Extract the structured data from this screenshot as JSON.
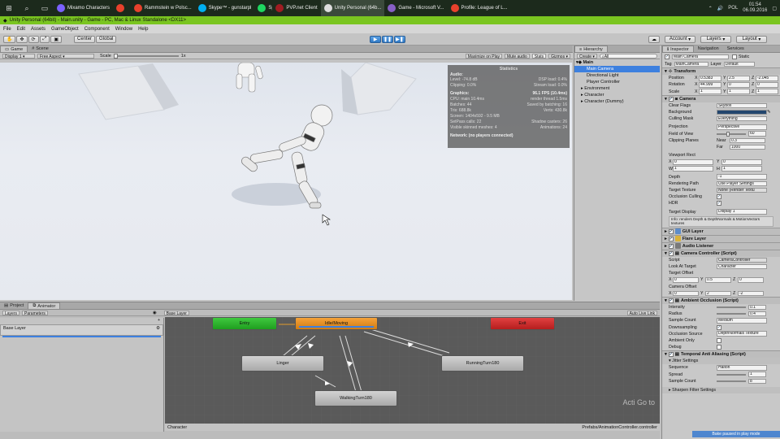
{
  "taskbar": {
    "items": [
      {
        "label": "Mixamo Characters",
        "color": "#7b61ff"
      },
      {
        "label": "",
        "color": "#e8412c"
      },
      {
        "label": "Rammstein w Polsc...",
        "color": "#e8412c"
      },
      {
        "label": "Skype™ - gunstarpl",
        "color": "#00aff0"
      },
      {
        "label": "Spotify",
        "color": "#1ed760"
      },
      {
        "label": "PVP.net Client",
        "color": "#a01c22"
      },
      {
        "label": "Unity Personal (64b...",
        "color": "#dddddd"
      },
      {
        "label": "Game - Microsoft V...",
        "color": "#865fc5"
      },
      {
        "label": "Profile: League of L...",
        "color": "#e8412c"
      }
    ],
    "lang": "POL",
    "time": "01:54",
    "date": "06.09.2016"
  },
  "window": {
    "title": "Unity Personal (64bit) - Main.unity - Game - PC, Mac & Linux Standalone <DX11>"
  },
  "menu": [
    "File",
    "Edit",
    "Assets",
    "GameObject",
    "Component",
    "Window",
    "Help"
  ],
  "toolbar": {
    "pivot": "Center",
    "space": "Global",
    "account": "Account",
    "layers": "Layers",
    "layout": "Layout"
  },
  "game": {
    "tabs": [
      "Game",
      "Scene"
    ],
    "display": "Display 1",
    "aspect": "Free Aspect",
    "scale_label": "Scale",
    "scale_value": "1x",
    "maximize": "Maximize on Play",
    "mute": "Mute audio",
    "stats": "Stats",
    "gizmos": "Gizmos"
  },
  "stats": {
    "title": "Statistics",
    "audio_h": "Audio:",
    "audio": [
      [
        "Level: -74.8 dB",
        "DSP load: 0.4%"
      ],
      [
        "Clipping: 0.0%",
        "Stream load: 0.0%"
      ]
    ],
    "graphics_h": "Graphics:",
    "fps": "96.1 FPS (10.4ms)",
    "graphics": [
      [
        "CPU: main 10.4ms",
        "render thread 1.5ms"
      ],
      [
        "Batches: 44",
        "Saved by batching: 16"
      ],
      [
        "Tris: 688.8k",
        "Verts: 430.8k"
      ],
      [
        "Screen: 1404x592 - 9.5 MB",
        ""
      ],
      [
        "SetPass calls: 22",
        "Shadow casters: 26"
      ],
      [
        "Visible skinned meshes: 4",
        "Animations: 24"
      ]
    ],
    "network": "Network: (no players connected)"
  },
  "hierarchy": {
    "title": "Hierarchy",
    "create": "Create",
    "search": "All",
    "scene": "Main",
    "items": [
      "Main Camera",
      "Directional Light",
      "Player Controller",
      "Environment",
      "Character",
      "Character (Dummy)"
    ]
  },
  "inspector": {
    "tabs": [
      "Inspector",
      "Navigation",
      "Services"
    ],
    "object_name": "Main Camera",
    "static": "Static",
    "tag_label": "Tag",
    "tag": "MainCamera",
    "layer_label": "Layer",
    "layer": "Default",
    "transform": {
      "title": "Transform",
      "position": [
        "0.5383",
        "2.5",
        "-2.045"
      ],
      "rotation": [
        "44.999",
        "0",
        "0"
      ],
      "scale": [
        "1",
        "1",
        "1"
      ]
    },
    "camera": {
      "title": "Camera",
      "clear_flags": "Skybox",
      "background_color": "#23466e",
      "culling_mask": "Everything",
      "projection": "Perspective",
      "fov": "60",
      "near": "0.3",
      "far": "1000",
      "viewport": [
        "0",
        "0",
        "1",
        "1"
      ],
      "depth": "-1",
      "rendering_path": "Use Player Settings",
      "target_texture": "None (Render Textu",
      "target_display": "Display 1",
      "info": "Info: renders Depth & DepthNormals & MotionVectors textures"
    },
    "labels": {
      "clear_flags": "Clear Flags",
      "background": "Background",
      "culling_mask": "Culling Mask",
      "projection": "Projection",
      "fov": "Field of View",
      "clipping": "Clipping Planes",
      "near": "Near",
      "far": "Far",
      "viewport": "Viewport Rect",
      "depth": "Depth",
      "rendering_path": "Rendering Path",
      "target_texture": "Target Texture",
      "occlusion": "Occlusion Culling",
      "hdr": "HDR",
      "target_display": "Target Display",
      "position": "Position",
      "rotation": "Rotation",
      "scale": "Scale"
    },
    "components": [
      "GUI Layer",
      "Flare Layer",
      "Audio Listener"
    ],
    "controller": {
      "title": "Camera Controller (Script)",
      "script_label": "Script",
      "script": "CameraController",
      "look_label": "Look At Target",
      "look": "Character",
      "target_offset_label": "Target Offset",
      "target_offset": [
        "0",
        "0.5",
        "0"
      ],
      "camera_offset_label": "Camera Offset",
      "camera_offset": [
        "0",
        "2",
        "-2"
      ]
    },
    "ao": {
      "title": "Ambient Occlusion (Script)",
      "rows": [
        [
          "Intensity",
          "0.1"
        ],
        [
          "Radius",
          "0.4"
        ],
        [
          "Sample Count",
          "Medium"
        ],
        [
          "Downsampling",
          ""
        ],
        [
          "Occlusion Source",
          "DepthNormals Texture"
        ],
        [
          "Ambient Only",
          ""
        ],
        [
          "Debug",
          ""
        ]
      ]
    },
    "taa": {
      "title": "Temporal Anti Aliasing (Script)",
      "jitter": "Jitter Settings",
      "rows": [
        [
          "Sequence",
          "Halton"
        ],
        [
          "Spread",
          "1"
        ],
        [
          "Sample Count",
          "8"
        ]
      ],
      "sharpen": "Sharpen Filter Settings"
    },
    "bake_status": "Bake paused in play mode"
  },
  "bottom": {
    "tabs": [
      "Project",
      "Animator"
    ],
    "subtabs": [
      "Layers",
      "Parameters"
    ],
    "base_layer": "Base Layer",
    "breadcrumb": "Base Layer",
    "auto_live": "Auto Live Link",
    "states": {
      "entry": "Entry",
      "idle": "Idle/Moving",
      "exit": "Exit",
      "linger": "Linger",
      "running": "RunningTurn180",
      "walking": "WalkingTurn180"
    },
    "footer_left": "Character",
    "footer_right": "Prefabs/AnimationController.controller",
    "watermark": "Acti Go to"
  }
}
